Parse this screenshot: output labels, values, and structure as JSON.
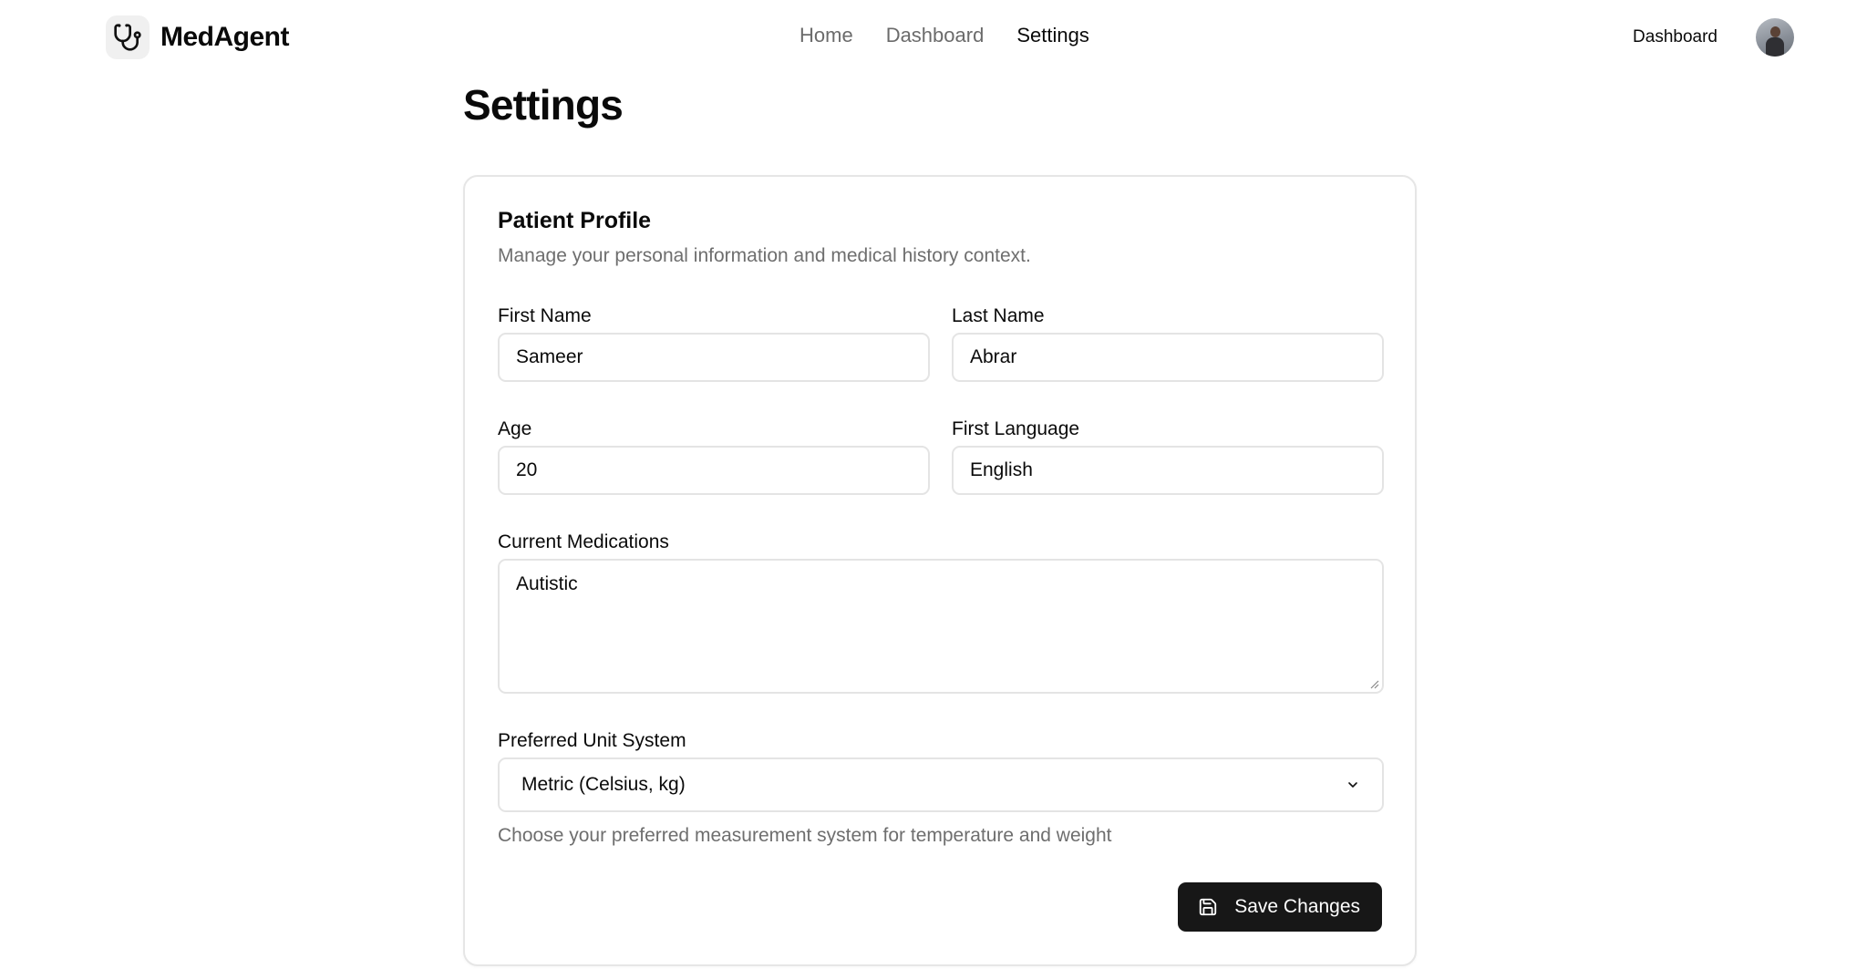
{
  "brand": {
    "name": "MedAgent",
    "logo_icon": "stethoscope-icon"
  },
  "nav": {
    "items": [
      {
        "label": "Home",
        "active": false
      },
      {
        "label": "Dashboard",
        "active": false
      },
      {
        "label": "Settings",
        "active": true
      }
    ]
  },
  "header_right": {
    "link_label": "Dashboard",
    "avatar_icon": "user-avatar"
  },
  "page": {
    "title": "Settings"
  },
  "profile": {
    "title": "Patient Profile",
    "description": "Manage your personal information and medical history context.",
    "first_name": {
      "label": "First Name",
      "value": "Sameer"
    },
    "last_name": {
      "label": "Last Name",
      "value": "Abrar"
    },
    "age": {
      "label": "Age",
      "value": "20"
    },
    "first_language": {
      "label": "First Language",
      "value": "English"
    },
    "medications": {
      "label": "Current Medications",
      "value": "Autistic"
    },
    "unit_system": {
      "label": "Preferred Unit System",
      "selected": "Metric (Celsius, kg)",
      "hint": "Choose your preferred measurement system for temperature and weight"
    },
    "save_label": "Save Changes",
    "save_icon": "save-icon"
  },
  "colors": {
    "primary_button": "#171717",
    "border": "#e4e4e4",
    "muted_text": "#6e6e6e"
  }
}
